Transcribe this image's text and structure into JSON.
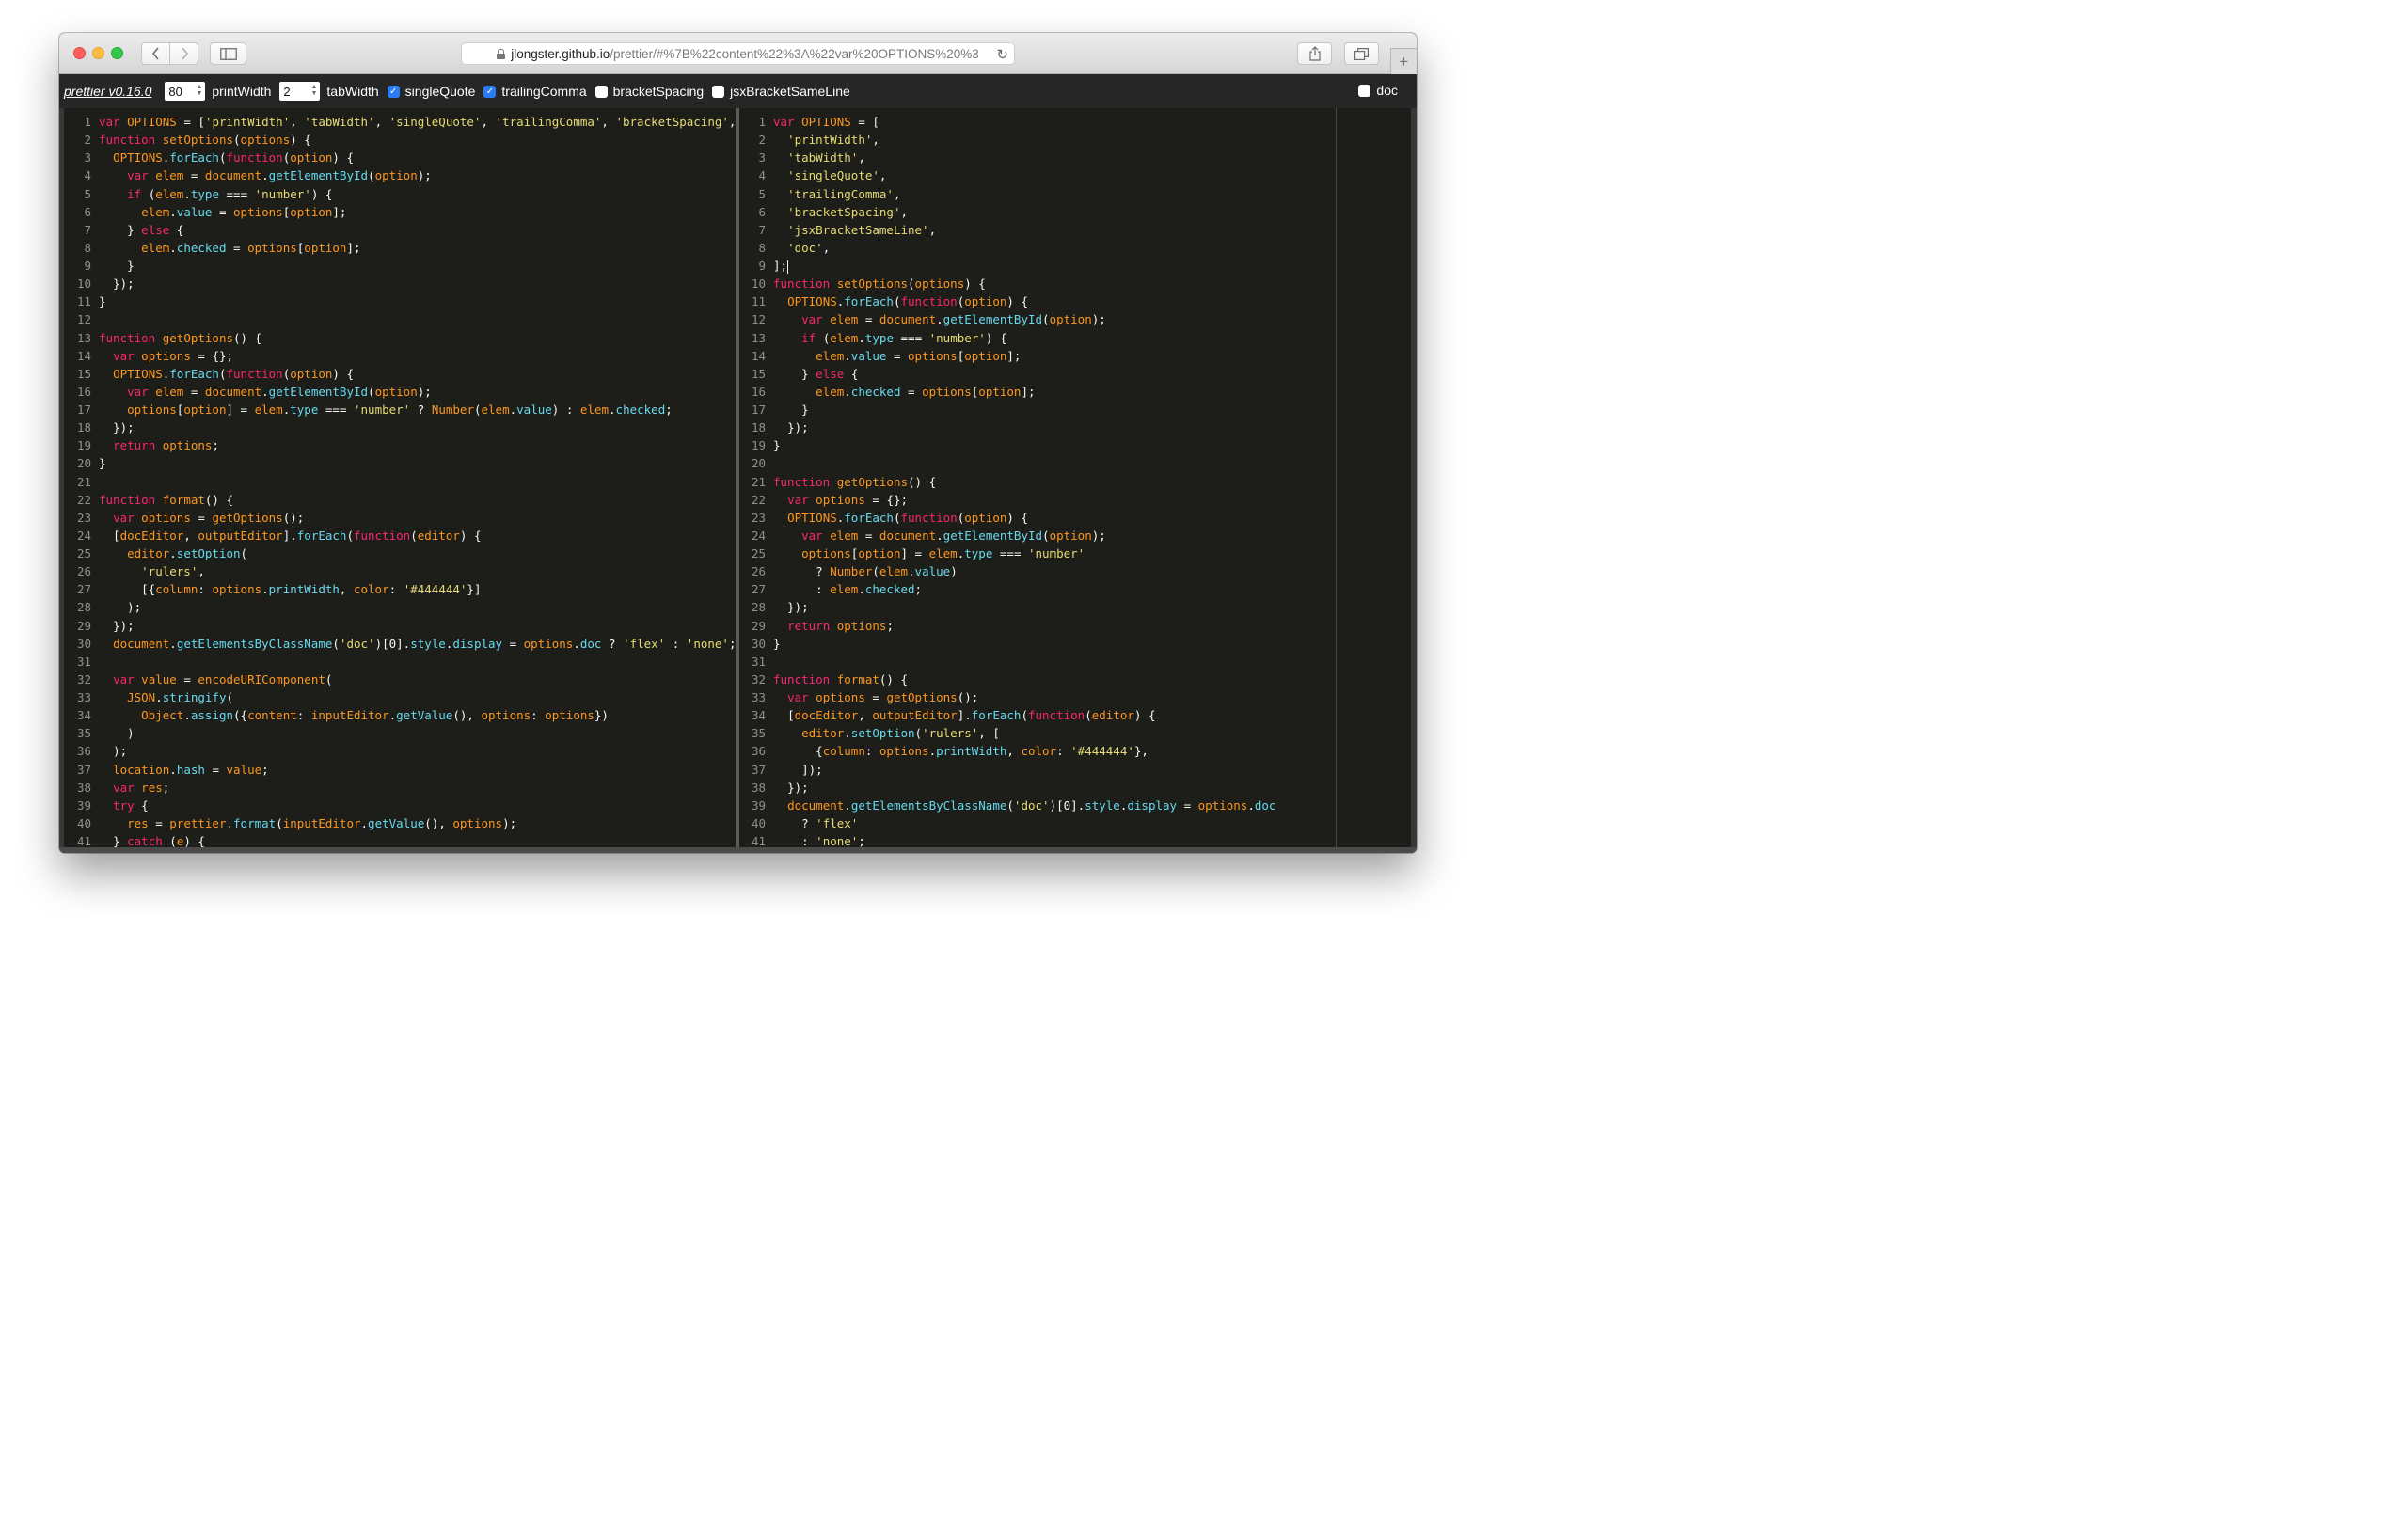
{
  "browser": {
    "url_host": "jlongster.github.io",
    "url_path": "/prettier/#%7B%22content%22%3A%22var%20OPTIONS%20%3"
  },
  "toolbar": {
    "brand": "prettier v0.16.0",
    "print_width_value": "80",
    "print_width_label": "printWidth",
    "tab_width_value": "2",
    "tab_width_label": "tabWidth",
    "checkboxes": [
      {
        "label": "singleQuote",
        "checked": true
      },
      {
        "label": "trailingComma",
        "checked": true
      },
      {
        "label": "bracketSpacing",
        "checked": false
      },
      {
        "label": "jsxBracketSameLine",
        "checked": false
      }
    ],
    "doc_label": "doc",
    "doc_checked": false
  },
  "colors": {
    "keyword": "#f92672",
    "string": "#e6db74",
    "property": "#66d9ef",
    "function": "#fd971f",
    "editor_bg": "#1d1e19"
  },
  "input_editor": {
    "lines": [
      "var OPTIONS = ['printWidth', 'tabWidth', 'singleQuote', 'trailingComma', 'bracketSpacing',",
      "function setOptions(options) {",
      "  OPTIONS.forEach(function(option) {",
      "    var elem = document.getElementById(option);",
      "    if (elem.type === 'number') {",
      "      elem.value = options[option];",
      "    } else {",
      "      elem.checked = options[option];",
      "    }",
      "  });",
      "}",
      "",
      "function getOptions() {",
      "  var options = {};",
      "  OPTIONS.forEach(function(option) {",
      "    var elem = document.getElementById(option);",
      "    options[option] = elem.type === 'number' ? Number(elem.value) : elem.checked;",
      "  });",
      "  return options;",
      "}",
      "",
      "function format() {",
      "  var options = getOptions();",
      "  [docEditor, outputEditor].forEach(function(editor) {",
      "    editor.setOption(",
      "      'rulers',",
      "      [{column: options.printWidth, color: '#444444'}]",
      "    );",
      "  });",
      "  document.getElementsByClassName('doc')[0].style.display = options.doc ? 'flex' : 'none';",
      "",
      "  var value = encodeURIComponent(",
      "    JSON.stringify(",
      "      Object.assign({content: inputEditor.getValue(), options: options})",
      "    )",
      "  );",
      "  location.hash = value;",
      "  var res;",
      "  try {",
      "    res = prettier.format(inputEditor.getValue(), options);",
      "  } catch (e) {"
    ]
  },
  "output_editor": {
    "lines": [
      "var OPTIONS = [",
      "  'printWidth',",
      "  'tabWidth',",
      "  'singleQuote',",
      "  'trailingComma',",
      "  'bracketSpacing',",
      "  'jsxBracketSameLine',",
      "  'doc',",
      "];",
      "function setOptions(options) {",
      "  OPTIONS.forEach(function(option) {",
      "    var elem = document.getElementById(option);",
      "    if (elem.type === 'number') {",
      "      elem.value = options[option];",
      "    } else {",
      "      elem.checked = options[option];",
      "    }",
      "  });",
      "}",
      "",
      "function getOptions() {",
      "  var options = {};",
      "  OPTIONS.forEach(function(option) {",
      "    var elem = document.getElementById(option);",
      "    options[option] = elem.type === 'number'",
      "      ? Number(elem.value)",
      "      : elem.checked;",
      "  });",
      "  return options;",
      "}",
      "",
      "function format() {",
      "  var options = getOptions();",
      "  [docEditor, outputEditor].forEach(function(editor) {",
      "    editor.setOption('rulers', [",
      "      {column: options.printWidth, color: '#444444'},",
      "    ]);",
      "  });",
      "  document.getElementsByClassName('doc')[0].style.display = options.doc",
      "    ? 'flex'",
      "    : 'none';"
    ]
  }
}
